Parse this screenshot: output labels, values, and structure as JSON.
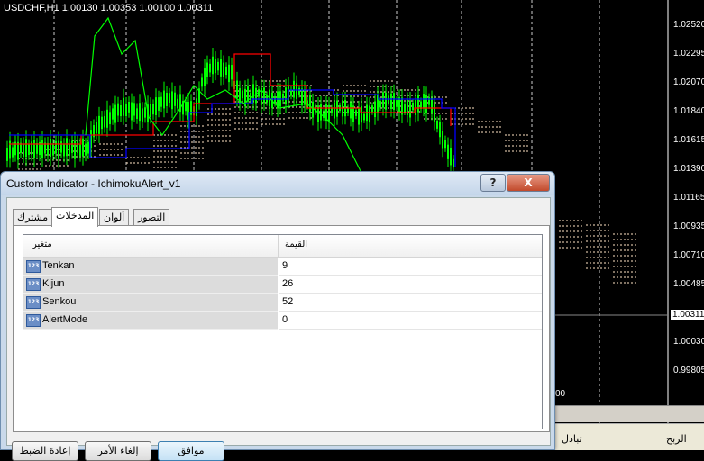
{
  "chart": {
    "ticker": "USDCHF,H1  1.00130 1.00353 1.00100 1.00311",
    "price_labels": [
      "1.02520",
      "1.02295",
      "1.02070",
      "1.01840",
      "1.01615",
      "1.01390",
      "1.01165",
      "1.00935",
      "1.00710",
      "1.00485",
      "1.00030",
      "0.99805"
    ],
    "current_price": "1.00311",
    "time_fragment": "00",
    "colors": {
      "candle": "#00ff00",
      "tenkan": "#ff0000",
      "kijun": "#0000ff",
      "chikou": "#00ff00",
      "cloud": "#ffe4c4",
      "grid": "#ffffff"
    }
  },
  "bottom_panel": {
    "col1": "تبادل",
    "col2": "الربح"
  },
  "dialog": {
    "title": "Custom Indicator - IchimokuAlert_v1",
    "help_label": "?",
    "close_label": "X",
    "tabs": [
      "مشترك",
      "المدخلات",
      "ألوان",
      "التصور"
    ],
    "active_tab": "المدخلات",
    "table": {
      "col_name": "متغير",
      "col_value": "القيمة",
      "icon": "123",
      "rows": [
        {
          "name": "Tenkan",
          "value": "9"
        },
        {
          "name": "Kijun",
          "value": "26"
        },
        {
          "name": "Senkou",
          "value": "52"
        },
        {
          "name": "AlertMode",
          "value": "0"
        }
      ]
    },
    "buttons": {
      "reset": "إعادة الضبط",
      "cancel": "إلغاء الأمر",
      "ok": "موافق"
    }
  }
}
